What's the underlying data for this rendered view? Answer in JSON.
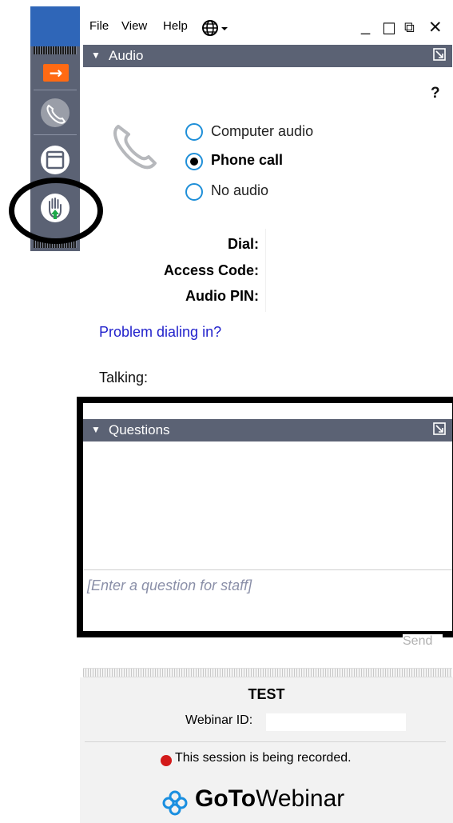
{
  "menu": {
    "file": "File",
    "view": "View",
    "help": "Help"
  },
  "window_controls": {
    "minimize": "_",
    "maximize": "☐",
    "popout": "⧉",
    "close": "✕"
  },
  "audio": {
    "title": "Audio",
    "help_mark": "?",
    "options": [
      {
        "label": "Computer audio",
        "selected": false
      },
      {
        "label": "Phone call",
        "selected": true
      },
      {
        "label": "No audio",
        "selected": false
      }
    ],
    "dial_label": "Dial:",
    "access_code_label": "Access Code:",
    "audio_pin_label": "Audio PIN:",
    "problem_link": "Problem dialing in?",
    "talking_label": "Talking:"
  },
  "questions": {
    "title": "Questions",
    "placeholder": "[Enter a question for staff]",
    "send_label": "Send"
  },
  "footer": {
    "title": "TEST",
    "webinar_id_label": "Webinar ID:",
    "recording_notice": "This session is being recorded.",
    "brand_bold": "GoTo",
    "brand_regular": "Webinar"
  },
  "colors": {
    "header_bg": "#5b6274",
    "accent_orange": "#ff6a13",
    "radio_blue": "#1f8fd8",
    "link_blue": "#2222cc",
    "record_red": "#d31a1a"
  }
}
